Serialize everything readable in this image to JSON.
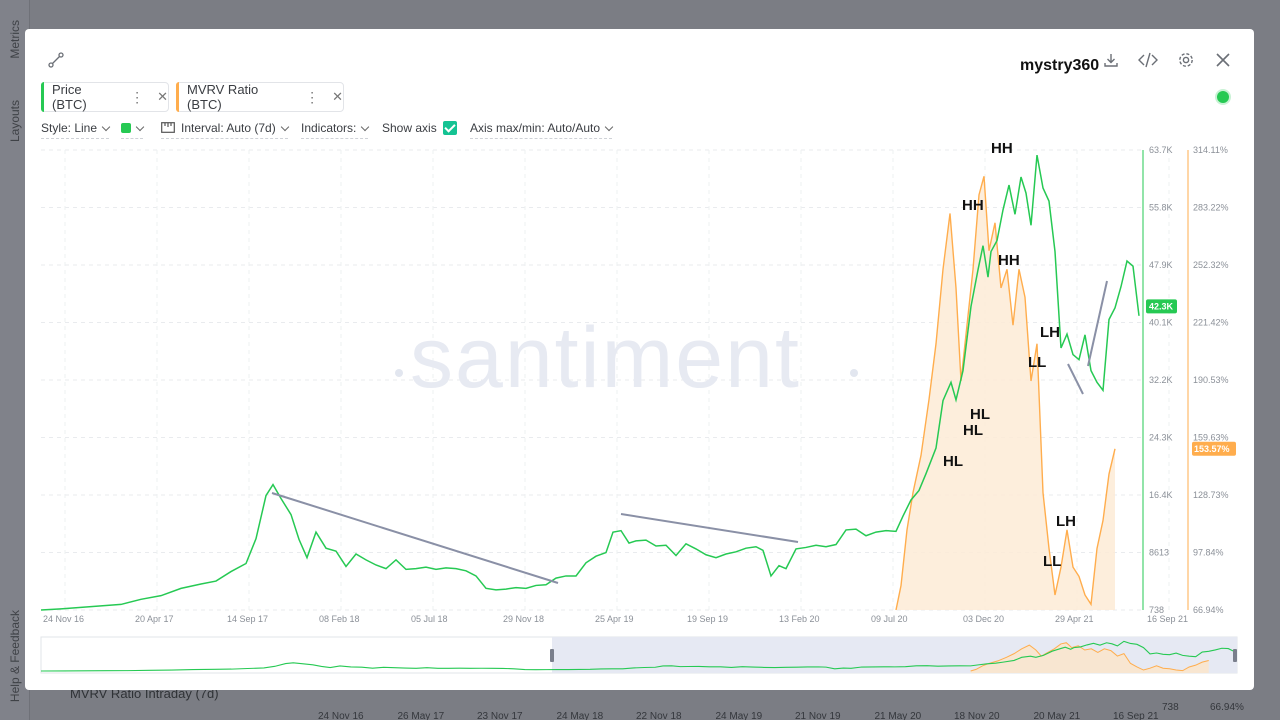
{
  "background": {
    "sidebar_tabs": [
      "Metrics",
      "Layouts"
    ],
    "help_label": "Help & Feedback",
    "bottom_item": "MVRV Ratio Intraday (7d)",
    "axis_dates": [
      "24 Nov 16",
      "26 May 17",
      "23 Nov 17",
      "24 May 18",
      "22 Nov 18",
      "24 May 19",
      "21 Nov 19",
      "21 May 20",
      "18 Nov 20",
      "20 May 21",
      "16 Sep 21"
    ],
    "axis_values": [
      "738",
      "66.94%"
    ]
  },
  "header": {
    "user_watermark": "mystry360",
    "icons": [
      "share-icon",
      "download-icon",
      "embed-code-icon",
      "settings-icon",
      "close-icon"
    ]
  },
  "metrics": [
    {
      "label": "Price (BTC)",
      "color": "#26c953"
    },
    {
      "label": "MVRV Ratio (BTC)",
      "color": "#ffad4d"
    }
  ],
  "toolbar": {
    "style_label": "Style: Line",
    "interval_label": "Interval: Auto (7d)",
    "indicators_label": "Indicators:",
    "show_axis_label": "Show axis",
    "axis_maxmin_label": "Axis max/min: Auto/Auto"
  },
  "chart_data": {
    "type": "line",
    "watermark": "santiment",
    "x_ticks": [
      "24 Nov 16",
      "20 Apr 17",
      "14 Sep 17",
      "08 Feb 18",
      "05 Jul 18",
      "29 Nov 18",
      "25 Apr 19",
      "19 Sep 19",
      "13 Feb 20",
      "09 Jul 20",
      "03 Dec 20",
      "29 Apr 21",
      "16 Sep 21"
    ],
    "y_price_ticks": [
      "63.7K",
      "55.8K",
      "47.9K",
      "40.1K",
      "32.2K",
      "24.3K",
      "16.4K",
      "8613",
      "738"
    ],
    "y_price_range": [
      738,
      63700
    ],
    "y_mvrv_ticks": [
      "314.11%",
      "283.22%",
      "252.32%",
      "221.42%",
      "190.53%",
      "159.63%",
      "128.73%",
      "97.84%",
      "66.94%"
    ],
    "y_mvrv_range": [
      66.94,
      314.11
    ],
    "current_price_label": "42.3K",
    "current_mvrv_label": "153.57%",
    "series": [
      {
        "name": "Price (BTC)",
        "color": "#26c953",
        "points": [
          [
            0,
            738
          ],
          [
            20,
            900
          ],
          [
            40,
            1100
          ],
          [
            60,
            1300
          ],
          [
            80,
            1500
          ],
          [
            100,
            2200
          ],
          [
            120,
            2700
          ],
          [
            140,
            3700
          ],
          [
            160,
            4300
          ],
          [
            175,
            4700
          ],
          [
            190,
            6000
          ],
          [
            205,
            7100
          ],
          [
            215,
            10500
          ],
          [
            225,
            16400
          ],
          [
            232,
            17900
          ],
          [
            240,
            16000
          ],
          [
            250,
            13800
          ],
          [
            258,
            10400
          ],
          [
            266,
            7900
          ],
          [
            275,
            11400
          ],
          [
            285,
            9200
          ],
          [
            295,
            8800
          ],
          [
            305,
            6700
          ],
          [
            315,
            8400
          ],
          [
            325,
            7600
          ],
          [
            335,
            6900
          ],
          [
            345,
            6400
          ],
          [
            355,
            7600
          ],
          [
            365,
            6300
          ],
          [
            375,
            6400
          ],
          [
            385,
            6600
          ],
          [
            395,
            6300
          ],
          [
            405,
            6500
          ],
          [
            415,
            6400
          ],
          [
            425,
            6100
          ],
          [
            435,
            5400
          ],
          [
            445,
            3700
          ],
          [
            455,
            3500
          ],
          [
            465,
            3600
          ],
          [
            475,
            3800
          ],
          [
            485,
            3700
          ],
          [
            495,
            4100
          ],
          [
            505,
            4200
          ],
          [
            515,
            5100
          ],
          [
            525,
            5400
          ],
          [
            535,
            5400
          ],
          [
            545,
            7200
          ],
          [
            555,
            8100
          ],
          [
            565,
            8600
          ],
          [
            572,
            11400
          ],
          [
            580,
            11600
          ],
          [
            588,
            9900
          ],
          [
            595,
            10200
          ],
          [
            605,
            10300
          ],
          [
            615,
            9500
          ],
          [
            625,
            9600
          ],
          [
            635,
            8200
          ],
          [
            645,
            9800
          ],
          [
            655,
            9100
          ],
          [
            665,
            8300
          ],
          [
            675,
            7900
          ],
          [
            685,
            8400
          ],
          [
            695,
            8700
          ],
          [
            705,
            9200
          ],
          [
            715,
            9400
          ],
          [
            722,
            8900
          ],
          [
            730,
            5400
          ],
          [
            738,
            6800
          ],
          [
            745,
            6400
          ],
          [
            755,
            9100
          ],
          [
            765,
            9300
          ],
          [
            775,
            9600
          ],
          [
            785,
            9400
          ],
          [
            795,
            9700
          ],
          [
            805,
            11700
          ],
          [
            815,
            11800
          ],
          [
            825,
            10900
          ],
          [
            835,
            11400
          ],
          [
            845,
            11600
          ],
          [
            855,
            11500
          ],
          [
            862,
            13600
          ],
          [
            870,
            15800
          ],
          [
            878,
            17100
          ],
          [
            885,
            19400
          ],
          [
            895,
            22900
          ],
          [
            902,
            29400
          ],
          [
            910,
            31900
          ],
          [
            915,
            29500
          ],
          [
            922,
            33500
          ],
          [
            930,
            42300
          ],
          [
            937,
            47300
          ],
          [
            942,
            50600
          ],
          [
            947,
            46300
          ],
          [
            950,
            49800
          ],
          [
            956,
            51300
          ],
          [
            962,
            55500
          ],
          [
            968,
            58900
          ],
          [
            974,
            54900
          ],
          [
            980,
            60000
          ],
          [
            985,
            57800
          ],
          [
            990,
            53400
          ],
          [
            996,
            63000
          ],
          [
            1002,
            58500
          ],
          [
            1008,
            56700
          ],
          [
            1014,
            49800
          ],
          [
            1020,
            36600
          ],
          [
            1026,
            38500
          ],
          [
            1032,
            35700
          ],
          [
            1038,
            35000
          ],
          [
            1044,
            38400
          ],
          [
            1050,
            33500
          ],
          [
            1056,
            31900
          ],
          [
            1062,
            30800
          ],
          [
            1068,
            40500
          ],
          [
            1074,
            42100
          ],
          [
            1080,
            45000
          ],
          [
            1086,
            48500
          ],
          [
            1092,
            47800
          ],
          [
            1098,
            41000
          ]
        ]
      },
      {
        "name": "MVRV Ratio (BTC)",
        "color": "#ffad4d",
        "points": [
          [
            855,
            66.94
          ],
          [
            860,
            80
          ],
          [
            866,
            110
          ],
          [
            872,
            130
          ],
          [
            880,
            150
          ],
          [
            888,
            180
          ],
          [
            895,
            210
          ],
          [
            902,
            250
          ],
          [
            909,
            280
          ],
          [
            915,
            240
          ],
          [
            920,
            190
          ],
          [
            926,
            220
          ],
          [
            932,
            250
          ],
          [
            938,
            290
          ],
          [
            943,
            300
          ],
          [
            948,
            260
          ],
          [
            954,
            275
          ],
          [
            960,
            240
          ],
          [
            966,
            250
          ],
          [
            972,
            220
          ],
          [
            978,
            250
          ],
          [
            984,
            235
          ],
          [
            990,
            190
          ],
          [
            996,
            210
          ],
          [
            1002,
            130
          ],
          [
            1008,
            100
          ],
          [
            1014,
            75
          ],
          [
            1020,
            90
          ],
          [
            1026,
            110
          ],
          [
            1032,
            90
          ],
          [
            1038,
            85
          ],
          [
            1044,
            75
          ],
          [
            1050,
            70
          ],
          [
            1056,
            100
          ],
          [
            1062,
            115
          ],
          [
            1068,
            140
          ],
          [
            1074,
            153.57
          ]
        ]
      }
    ],
    "annotations": [
      "HH",
      "HH",
      "HL",
      "HL",
      "HH",
      "HL",
      "LH",
      "LL",
      "LH",
      "LL"
    ],
    "navigator": true
  }
}
